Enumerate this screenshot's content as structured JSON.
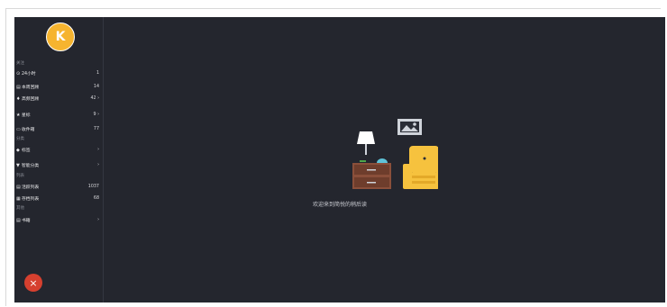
{
  "avatar": {
    "initial": "K"
  },
  "sections": {
    "follow": "关注",
    "tags": "分类",
    "lists": "列表",
    "other": "其他"
  },
  "items": [
    {
      "label": "24小时",
      "count": "1",
      "icon": "clock-icon",
      "glyph": "⊙"
    },
    {
      "label": "本周回顾",
      "count": "14",
      "icon": "calendar-icon",
      "glyph": "▤"
    },
    {
      "label": "高频回顾",
      "count": "42 ›",
      "icon": "location-pin-icon",
      "glyph": "♦"
    },
    {
      "label": "星标",
      "count": "9 ›",
      "icon": "star-icon",
      "glyph": "★"
    },
    {
      "label": "收件箱",
      "count": "77",
      "icon": "inbox-icon",
      "glyph": "▭"
    },
    {
      "label": "标签",
      "count": "›",
      "icon": "tag-icon",
      "glyph": "◆"
    },
    {
      "label": "智能分类",
      "count": "›",
      "icon": "filter-icon",
      "glyph": "▼"
    },
    {
      "label": "活跃列表",
      "count": "1037",
      "icon": "list-icon",
      "glyph": "▤"
    },
    {
      "label": "存档列表",
      "count": "68",
      "icon": "archive-icon",
      "glyph": "▦"
    },
    {
      "label": "书籍",
      "count": "›",
      "icon": "book-icon",
      "glyph": "▤"
    }
  ],
  "fab": {
    "label": "×",
    "icon": "close-icon"
  },
  "main": {
    "welcome_text": "欢迎来到简悦的稍后读"
  },
  "colors": {
    "background": "#24262e",
    "avatar": "#f6b42f",
    "fab": "#d6402f",
    "chair": "#f6c23e",
    "nightstand": "#8a4f3a",
    "lamp_shade": "#ffffff",
    "picture_frame": "#cfd3da"
  }
}
